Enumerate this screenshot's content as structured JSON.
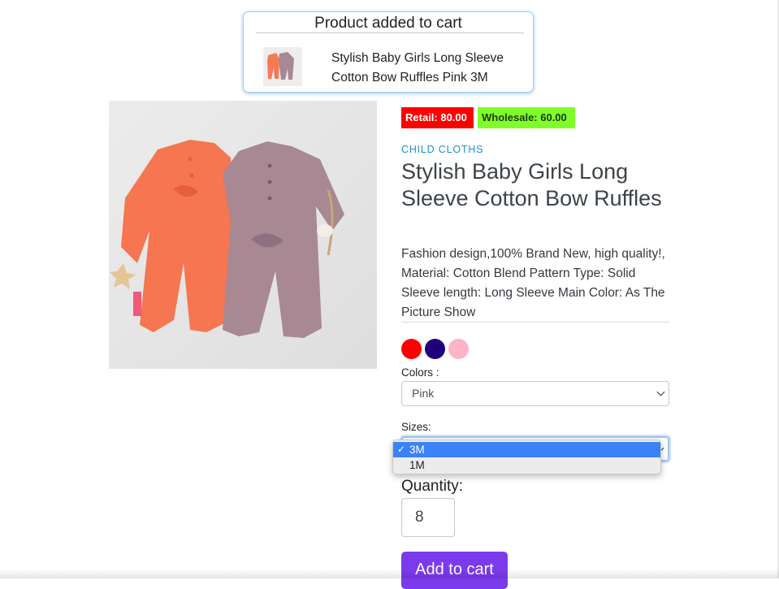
{
  "toast": {
    "title": "Product added to cart",
    "item_name_line1": "Stylish Baby Girls Long Sleeve",
    "item_name_line2": "Cotton Bow Ruffles Pink 3M"
  },
  "product": {
    "retail_price": "Retail: 80.00",
    "wholesale_price": "Wholesale: 60.00",
    "category": "CHILD CLOTHS",
    "title": "Stylish Baby Girls Long Sleeve Cotton Bow Ruffles",
    "description": "Fashion design,100% Brand New, high quality!, Material: Cotton Blend Pattern Type: Solid Sleeve length: Long Sleeve Main Color: As The Picture Show",
    "swatches": [
      "#ff0000",
      "#1f007a",
      "#ffb3c7"
    ],
    "colors_label": "Colors :",
    "colors_selected": "Pink",
    "sizes_label": "Sizes:",
    "size_options": [
      "3M",
      "1M"
    ],
    "size_selected": "3M",
    "quantity_label": "Quantity:",
    "quantity_value": "8",
    "add_to_cart_label": "Add to cart"
  },
  "icons": {
    "check": "checkmark-icon",
    "chevron": "chevron-down-icon"
  }
}
